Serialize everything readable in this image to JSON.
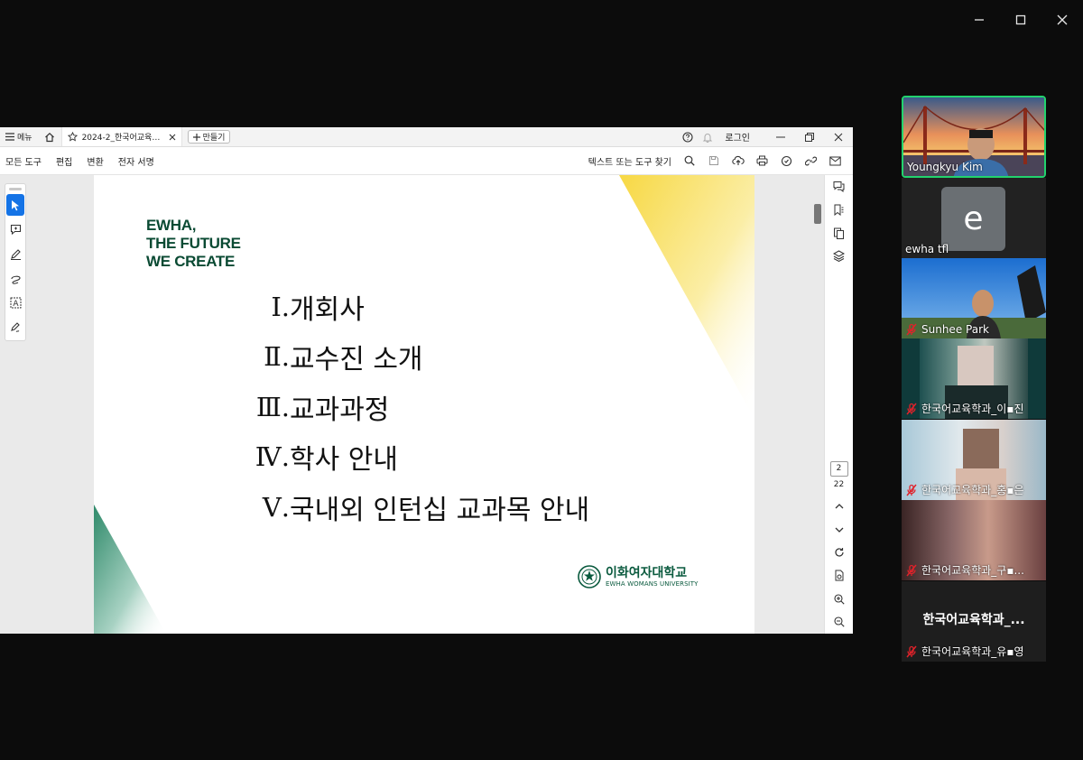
{
  "window": {
    "minimize_icon": "minimize-icon",
    "maximize_icon": "maximize-icon",
    "close_icon": "close-icon"
  },
  "pdf": {
    "tabbar": {
      "menu_label": "메뉴",
      "tab_title": "2024-2_한국어교육학...",
      "new_label": "만들기",
      "login_label": "로그인"
    },
    "toolbar": {
      "menu_items": [
        "모든 도구",
        "편집",
        "변환",
        "전자 서명"
      ],
      "search_label": "텍스트 또는 도구 찾기"
    },
    "page": {
      "slogan": [
        "EWHA,",
        "THE FUTURE",
        "WE CREATE"
      ],
      "toc": [
        {
          "num": "Ⅰ.",
          "label": "개회사"
        },
        {
          "num": "Ⅱ.",
          "label": "교수진 소개"
        },
        {
          "num": "Ⅲ.",
          "label": "교과과정"
        },
        {
          "num": "Ⅳ.",
          "label": "학사 안내"
        },
        {
          "num": "Ⅴ.",
          "label": "국내외 인턴십 교과목 안내"
        }
      ],
      "logo_kr": "이화여자대학교",
      "logo_en": "EWHA WOMANS UNIVERSITY"
    },
    "pager": {
      "current": "2",
      "total": "22"
    },
    "colors": {
      "accent": "#1473e6",
      "ewha_green": "#0a4a33"
    }
  },
  "participants": [
    {
      "name": "Youngkyu Kim",
      "muted": false,
      "active": true
    },
    {
      "name": "ewha tfl",
      "avatar_letter": "e",
      "muted": false
    },
    {
      "name": "Sunhee Park",
      "muted": true
    },
    {
      "name": "한국어교육학과_이▪진",
      "muted": true
    },
    {
      "name": "한국어교육학과_홍▪은",
      "muted": true
    },
    {
      "name": "한국어교육학과_구▪...",
      "muted": true
    },
    {
      "name": "한국어교육학과_유▪영",
      "display_name": "한국어교육학과_...",
      "muted": true
    }
  ]
}
